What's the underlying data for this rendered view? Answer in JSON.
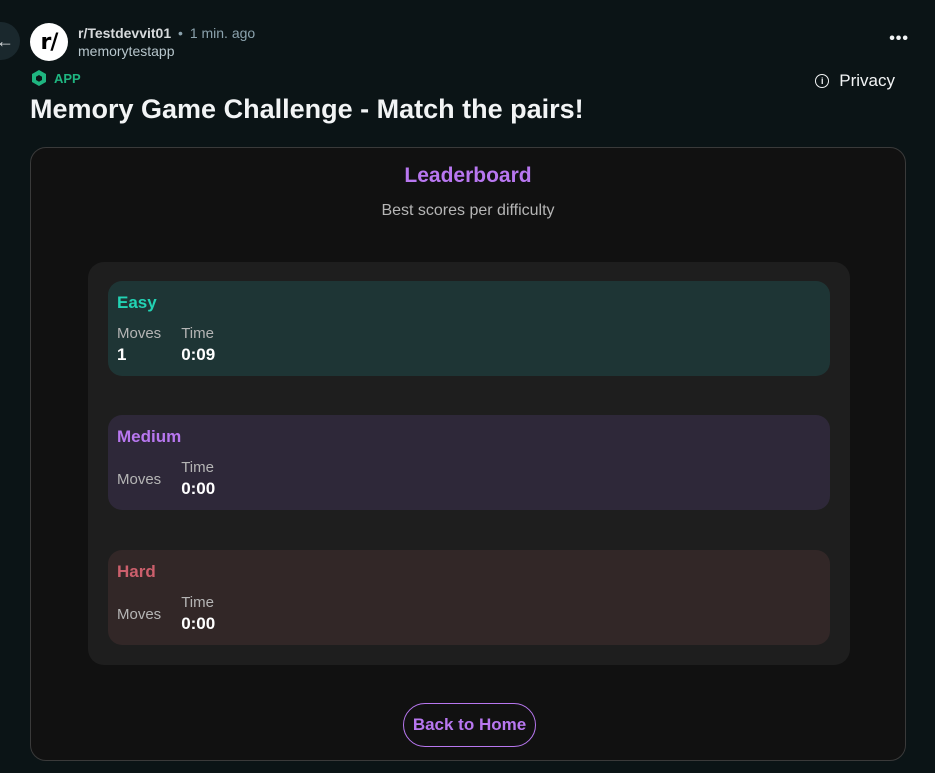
{
  "post": {
    "subreddit": "r/Testdevvit01",
    "separator": "•",
    "time": "1 min. ago",
    "username": "memorytestapp",
    "avatar_text": "r/",
    "app_badge": "APP",
    "privacy_label": "Privacy",
    "title": "Memory Game Challenge - Match the pairs!",
    "more_label": "•••"
  },
  "leaderboard": {
    "title": "Leaderboard",
    "subtitle": "Best scores per difficulty",
    "moves_label": "Moves",
    "time_label": "Time",
    "entries": [
      {
        "difficulty": "Easy",
        "moves": "1",
        "time": "0:09"
      },
      {
        "difficulty": "Medium",
        "moves": "",
        "time": "0:00"
      },
      {
        "difficulty": "Hard",
        "moves": "",
        "time": "0:00"
      }
    ],
    "back_button": "Back to Home"
  },
  "colors": {
    "background": "#0b1416",
    "accent_purple": "#b877f0",
    "easy": "#22d3b4",
    "medium": "#b877f0",
    "hard": "#cc5f6c",
    "app_badge": "#1fb580"
  },
  "icons": {
    "back": "back-arrow-icon",
    "more": "more-horizontal-icon",
    "app": "app-cube-icon",
    "privacy": "info-icon"
  }
}
